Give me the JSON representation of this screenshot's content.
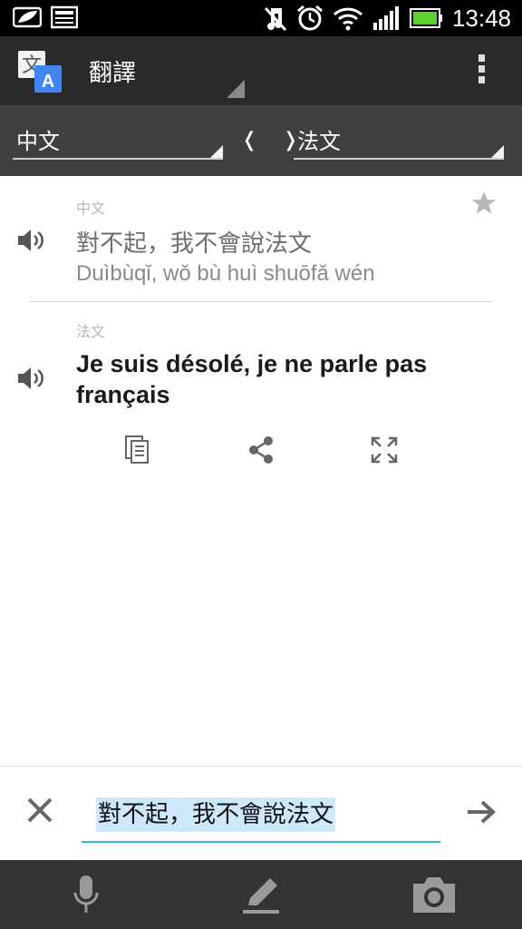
{
  "status_bar": {
    "time": "13:48",
    "icons": [
      "leaf-notification-icon",
      "news-notification-icon",
      "mute-icon",
      "alarm-icon",
      "wifi-icon",
      "signal-icon",
      "battery-icon"
    ]
  },
  "action_bar": {
    "app_title": "翻譯",
    "app_icon": "translate-icon",
    "app_icon_glyphs": {
      "char": "文",
      "letter": "A"
    },
    "menu_icon": "overflow-menu-icon"
  },
  "language_bar": {
    "source_language": "中文",
    "target_language": "法文",
    "swap_glyph": "❬ ❭"
  },
  "source": {
    "language_label": "中文",
    "text": "對不起，我不會說法文",
    "romanization": "Duìbùqǐ, wǒ bù huì shuōfǎ wén"
  },
  "target": {
    "language_label": "法文",
    "text": "Je suis désolé, je ne parle pas français"
  },
  "result_actions": [
    "copy-icon",
    "share-icon",
    "fullscreen-icon"
  ],
  "input": {
    "value": "對不起，我不會說法文",
    "clear_icon": "close-icon",
    "submit_icon": "arrow-right-icon"
  },
  "bottom_bar": [
    "microphone-icon",
    "pencil-icon",
    "camera-icon"
  ],
  "colors": {
    "action_bar": "#2a2a2a",
    "language_bar": "#404040",
    "accent": "#33b5e5",
    "selection": "#cde8f8",
    "bottom_bar": "#333333"
  }
}
